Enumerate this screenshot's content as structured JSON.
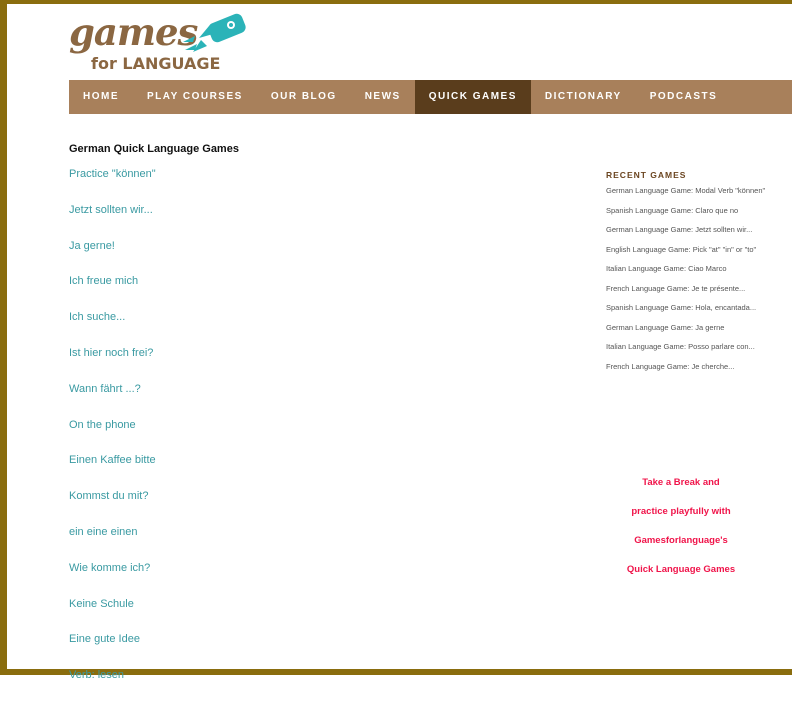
{
  "brand": {
    "logo_word": "games",
    "logo_sub": "for LANGUAGE",
    "color_brown": "#8b6742",
    "color_teal": "#2bb3b8"
  },
  "nav": {
    "items": [
      {
        "label": "HOME",
        "active": false
      },
      {
        "label": "PLAY COURSES",
        "active": false
      },
      {
        "label": "OUR BLOG",
        "active": false
      },
      {
        "label": "NEWS",
        "active": false
      },
      {
        "label": "QUICK GAMES",
        "active": true
      },
      {
        "label": "DICTIONARY",
        "active": false
      },
      {
        "label": "PODCASTS",
        "active": false
      }
    ]
  },
  "main": {
    "heading": "German Quick Language Games",
    "games": [
      "Practice \"können\"",
      "Jetzt sollten wir...",
      "Ja gerne!",
      "Ich freue mich",
      "Ich suche...",
      "Ist hier noch frei?",
      "Wann fährt ...?",
      "On the phone",
      "Einen Kaffee bitte",
      "Kommst du mit?",
      "ein eine einen",
      "Wie komme ich?",
      "Keine Schule",
      "Eine gute Idee",
      "Verb: lesen"
    ]
  },
  "sidebar": {
    "title": "RECENT GAMES",
    "recent": [
      "German Language Game: Modal Verb \"können\"",
      "Spanish Language Game: Claro que no",
      "German Language Game: Jetzt sollten wir...",
      "English Language Game: Pick \"at\" \"in\" or \"to\"",
      "Italian Language Game: Ciao Marco",
      "French Language Game: Je te présente...",
      "Spanish Language Game: Hola, encantada...",
      "German Language Game: Ja gerne",
      "Italian Language Game: Posso parlare con...",
      "French Language Game: Je cherche..."
    ],
    "promo": [
      "Take a Break and",
      "practice playfully with",
      "Gamesforlanguage's",
      "Quick Language Games"
    ]
  }
}
